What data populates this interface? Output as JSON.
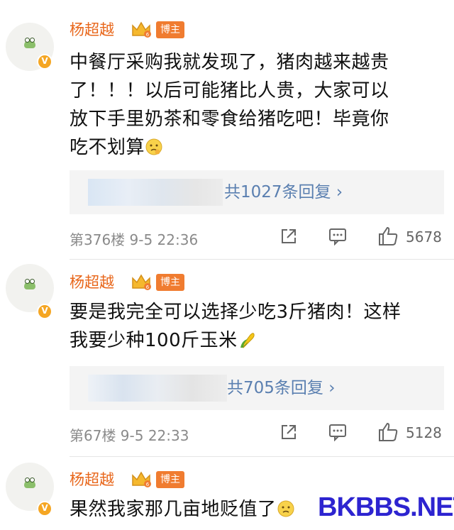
{
  "comments": [
    {
      "username": "杨超越",
      "badge": "博主",
      "text": "中餐厅采购我就发现了，猪肉越来越贵了！！！以后可能猪比人贵，大家可以放下手里奶茶和零食给猪吃吧！毕竟你吃不划算",
      "text_lines": [
        "中餐厅采购我就发现了，猪肉越来越贵",
        "了！！！以后可能猪比人贵，大家可以",
        "放下手里奶茶和零食给猪吃吧！毕竟你",
        "吃不划算"
      ],
      "trailing_emoji": "thinking-emoji",
      "reply_link": "共1027条回复 ›",
      "floor_time": "第376楼 9-5 22:36",
      "likes": "5678"
    },
    {
      "username": "杨超越",
      "badge": "博主",
      "text": "要是我完全可以选择少吃3斤猪肉！这样我要少种100斤玉米",
      "text_lines": [
        "要是我完全可以选择少吃3斤猪肉！这样",
        "我要少种100斤玉米"
      ],
      "trailing_emoji": "corn-emoji",
      "reply_link": "共705条回复 ›",
      "floor_time": "第67楼 9-5 22:33",
      "likes": "5128"
    },
    {
      "username": "杨超越",
      "badge": "博主",
      "text": "果然我家那几亩地贬值了",
      "text_lines": [
        "果然我家那几亩地贬值了"
      ],
      "trailing_emoji": "thinking-emoji"
    }
  ],
  "watermark": "BKBBS.NET",
  "colors": {
    "username": "#e8661a",
    "badge_bg": "#f07c30",
    "link": "#5a7fb0",
    "meta": "#8a8a8a",
    "watermark": "#2d24d0"
  },
  "icons": [
    "share-icon",
    "comment-icon",
    "like-icon",
    "crown-icon",
    "verified-v-icon"
  ]
}
